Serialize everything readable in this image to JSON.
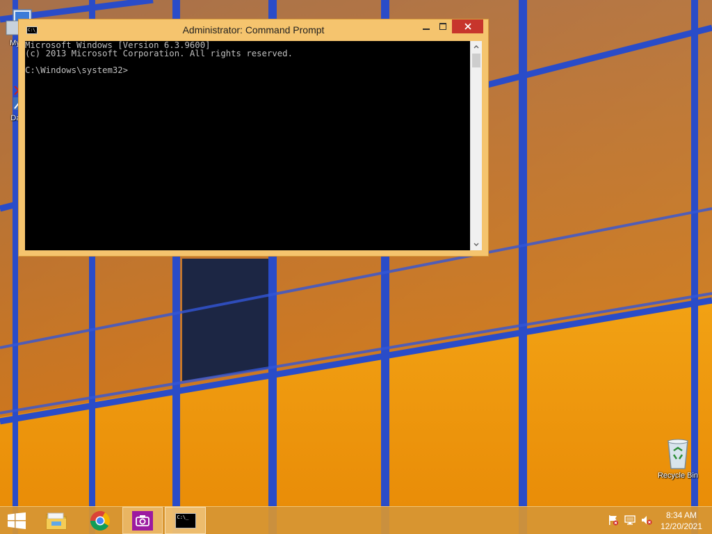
{
  "desktop": {
    "icons": [
      {
        "name": "My Computer",
        "label": "My C"
      },
      {
        "name": "Data",
        "label": "Data"
      },
      {
        "name": "Recycle Bin",
        "label": "Recycle Bin"
      }
    ]
  },
  "cmd_window": {
    "title": "Administrator: Command Prompt",
    "sys_icon_text": "C:\\_",
    "output_lines": [
      "Microsoft Windows [Version 6.3.9600]",
      "(c) 2013 Microsoft Corporation. All rights reserved.",
      "",
      "C:\\Windows\\system32>"
    ]
  },
  "taskbar": {
    "apps": [
      {
        "name": "Start",
        "icon": "windows-logo-icon"
      },
      {
        "name": "File Explorer",
        "icon": "folder-icon"
      },
      {
        "name": "Google Chrome",
        "icon": "chrome-icon"
      },
      {
        "name": "Camera",
        "icon": "camera-icon"
      },
      {
        "name": "Command Prompt",
        "icon": "cmd-icon",
        "icon_text": "C:\\_"
      }
    ],
    "tray": {
      "icons": [
        "action-center-flag-icon",
        "network-icon",
        "volume-muted-icon"
      ]
    },
    "clock": {
      "time": "8:34 AM",
      "date": "12/20/2021"
    }
  },
  "colors": {
    "window_frame": "#f5c46e",
    "close_button": "#c7352c",
    "console_bg": "#000000",
    "console_text": "#c0c0c0",
    "taskbar": "#d69634"
  }
}
